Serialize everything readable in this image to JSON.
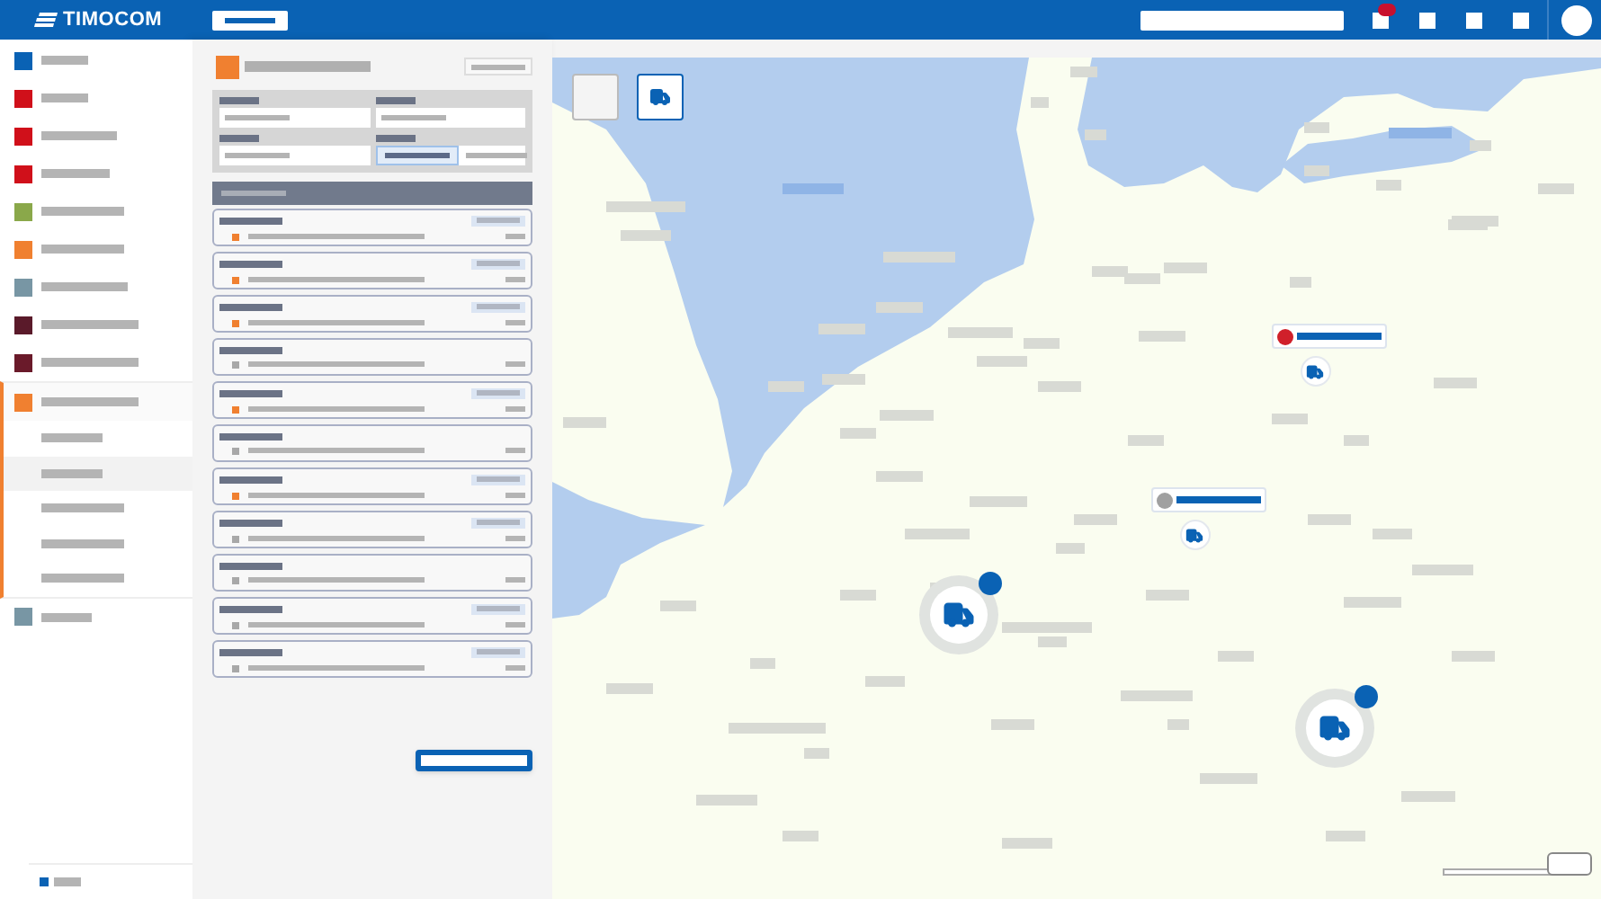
{
  "app_bar": {
    "logo_text": "TIMOCOM",
    "notification": true
  },
  "sidebar": {
    "items": [
      {
        "color": "#0a62b4",
        "expanded": false
      },
      {
        "color": "#d0101a",
        "expanded": false
      },
      {
        "color": "#d0101a",
        "expanded": false
      },
      {
        "color": "#d0101a",
        "expanded": false
      },
      {
        "color": "#8aa84a",
        "expanded": false
      },
      {
        "color": "#f08030",
        "expanded": false
      },
      {
        "color": "#7896a4",
        "expanded": false
      },
      {
        "color": "#5a1a2a",
        "expanded": false
      },
      {
        "color": "#6a1a2a",
        "expanded": false
      },
      {
        "color": "#f08030",
        "expanded": true,
        "children": [
          {
            "selected": false
          },
          {
            "selected": true
          },
          {
            "selected": false
          },
          {
            "selected": false
          },
          {
            "selected": false
          }
        ]
      },
      {
        "color": "#7896a4",
        "expanded": false
      }
    ],
    "footer": {
      "color": "#0a62b4"
    }
  },
  "panel": {
    "filters": [
      {
        "selected": false
      },
      {
        "selected": false
      },
      {
        "selected": false
      },
      {
        "selected": true
      }
    ],
    "cards": [
      {
        "color": "#f08030",
        "badge": true
      },
      {
        "color": "#f08030",
        "badge": true
      },
      {
        "color": "#f08030",
        "badge": true
      },
      {
        "color": "#a8a8a8",
        "badge": false
      },
      {
        "color": "#f08030",
        "badge": true
      },
      {
        "color": "#a8a8a8",
        "badge": false
      },
      {
        "color": "#f08030",
        "badge": true
      },
      {
        "color": "#a8a8a8",
        "badge": true
      },
      {
        "color": "#a8a8a8",
        "badge": false
      },
      {
        "color": "#a8a8a8",
        "badge": true
      },
      {
        "color": "#a8a8a8",
        "badge": true
      }
    ]
  },
  "map": {
    "controls": [
      {
        "selected": false
      },
      {
        "selected": true
      }
    ],
    "pins": [
      {
        "color": "#d0202a"
      },
      {
        "color": "#a0a0a0"
      }
    ]
  }
}
